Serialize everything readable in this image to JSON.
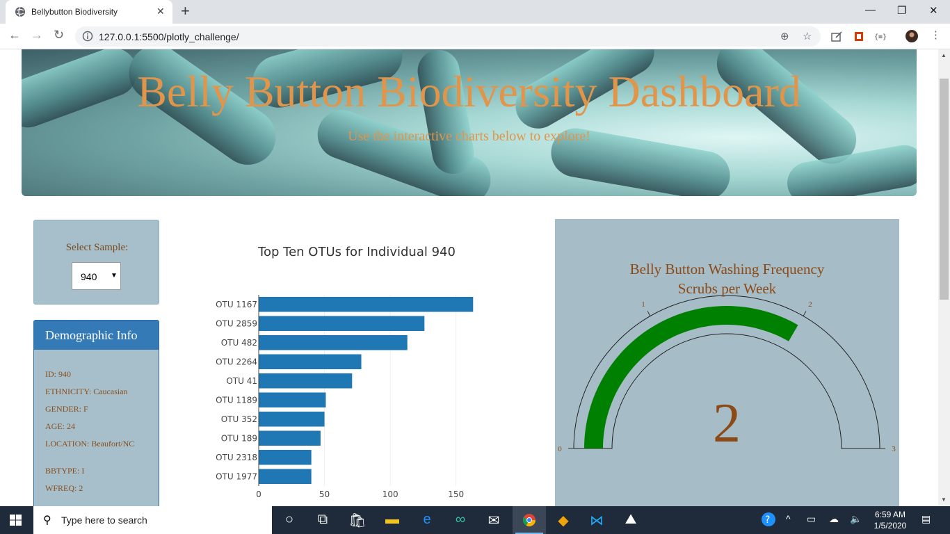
{
  "browser": {
    "tab_title": "Bellybutton Biodiversity",
    "tab_close": "✕",
    "new_tab": "+",
    "url": "127.0.0.1:5500/plotly_challenge/",
    "minimize": "—",
    "maximize": "❐",
    "close": "✕"
  },
  "header": {
    "title": "Belly Button Biodiversity Dashboard",
    "subtitle": "Use the interactive charts below to explore!"
  },
  "selector": {
    "label": "Select Sample:",
    "value": "940"
  },
  "demographics": {
    "title": "Demographic Info",
    "rows": [
      "ID: 940",
      "ETHNICITY: Caucasian",
      "GENDER: F",
      "AGE: 24",
      "LOCATION: Beaufort/NC",
      "BBTYPE: I",
      "WFREQ: 2"
    ]
  },
  "chart_data": [
    {
      "type": "bar",
      "orientation": "horizontal",
      "title": "Top Ten OTUs for Individual 940",
      "categories": [
        "OTU 1167",
        "OTU 2859",
        "OTU 482",
        "OTU 2264",
        "OTU 41",
        "OTU 1189",
        "OTU 352",
        "OTU 189",
        "OTU 2318",
        "OTU 1977"
      ],
      "values": [
        163,
        126,
        113,
        78,
        71,
        51,
        50,
        47,
        40,
        40
      ],
      "xlim": [
        0,
        175
      ],
      "xticks": [
        0,
        50,
        100,
        150
      ],
      "color": "#1f77b4"
    },
    {
      "type": "gauge",
      "title": "Belly Button Washing Frequency",
      "subtitle": "Scrubs per Week",
      "value": 2,
      "range": [
        0,
        3
      ],
      "ticks": [
        0,
        1,
        2,
        3
      ],
      "bar_color": "#008000"
    }
  ],
  "taskbar": {
    "search_placeholder": "Type here to search",
    "time": "6:59 AM",
    "date": "1/5/2020"
  }
}
